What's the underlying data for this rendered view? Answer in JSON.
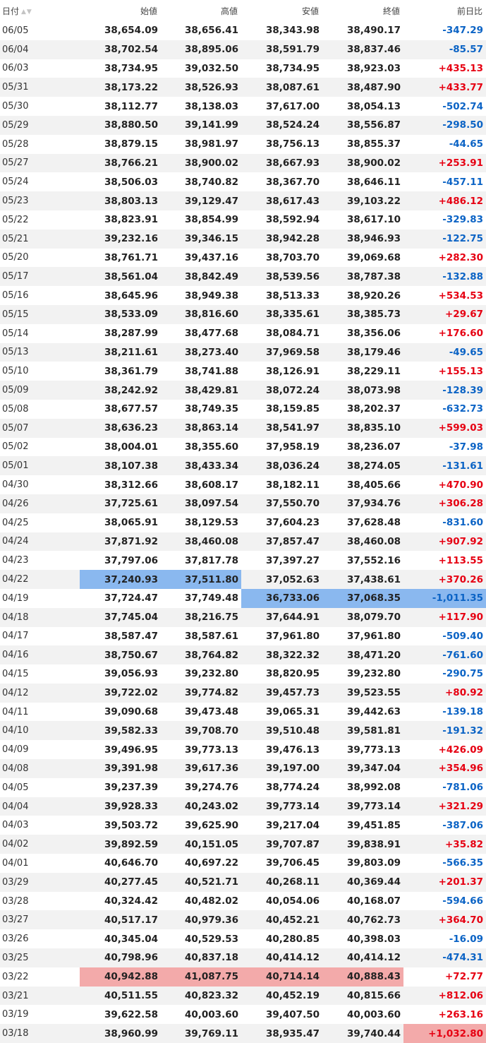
{
  "headers": {
    "date": "日付",
    "open": "始値",
    "high": "高値",
    "low": "安値",
    "close": "終値",
    "change": "前日比"
  },
  "colors": {
    "up": "#e60012",
    "down": "#0b63c5",
    "highlight_low": "#8ab8ef",
    "highlight_high": "#f3aaaa"
  },
  "rows": [
    {
      "date": "06/05",
      "open": "38,654.09",
      "high": "38,656.41",
      "low": "38,343.98",
      "close": "38,490.17",
      "change": "-347.29"
    },
    {
      "date": "06/04",
      "open": "38,702.54",
      "high": "38,895.06",
      "low": "38,591.79",
      "close": "38,837.46",
      "change": "-85.57"
    },
    {
      "date": "06/03",
      "open": "38,734.95",
      "high": "39,032.50",
      "low": "38,734.95",
      "close": "38,923.03",
      "change": "+435.13"
    },
    {
      "date": "05/31",
      "open": "38,173.22",
      "high": "38,526.93",
      "low": "38,087.61",
      "close": "38,487.90",
      "change": "+433.77"
    },
    {
      "date": "05/30",
      "open": "38,112.77",
      "high": "38,138.03",
      "low": "37,617.00",
      "close": "38,054.13",
      "change": "-502.74"
    },
    {
      "date": "05/29",
      "open": "38,880.50",
      "high": "39,141.99",
      "low": "38,524.24",
      "close": "38,556.87",
      "change": "-298.50"
    },
    {
      "date": "05/28",
      "open": "38,879.15",
      "high": "38,981.97",
      "low": "38,756.13",
      "close": "38,855.37",
      "change": "-44.65"
    },
    {
      "date": "05/27",
      "open": "38,766.21",
      "high": "38,900.02",
      "low": "38,667.93",
      "close": "38,900.02",
      "change": "+253.91"
    },
    {
      "date": "05/24",
      "open": "38,506.03",
      "high": "38,740.82",
      "low": "38,367.70",
      "close": "38,646.11",
      "change": "-457.11"
    },
    {
      "date": "05/23",
      "open": "38,803.13",
      "high": "39,129.47",
      "low": "38,617.43",
      "close": "39,103.22",
      "change": "+486.12"
    },
    {
      "date": "05/22",
      "open": "38,823.91",
      "high": "38,854.99",
      "low": "38,592.94",
      "close": "38,617.10",
      "change": "-329.83"
    },
    {
      "date": "05/21",
      "open": "39,232.16",
      "high": "39,346.15",
      "low": "38,942.28",
      "close": "38,946.93",
      "change": "-122.75"
    },
    {
      "date": "05/20",
      "open": "38,761.71",
      "high": "39,437.16",
      "low": "38,703.70",
      "close": "39,069.68",
      "change": "+282.30"
    },
    {
      "date": "05/17",
      "open": "38,561.04",
      "high": "38,842.49",
      "low": "38,539.56",
      "close": "38,787.38",
      "change": "-132.88"
    },
    {
      "date": "05/16",
      "open": "38,645.96",
      "high": "38,949.38",
      "low": "38,513.33",
      "close": "38,920.26",
      "change": "+534.53"
    },
    {
      "date": "05/15",
      "open": "38,533.09",
      "high": "38,816.60",
      "low": "38,335.61",
      "close": "38,385.73",
      "change": "+29.67"
    },
    {
      "date": "05/14",
      "open": "38,287.99",
      "high": "38,477.68",
      "low": "38,084.71",
      "close": "38,356.06",
      "change": "+176.60"
    },
    {
      "date": "05/13",
      "open": "38,211.61",
      "high": "38,273.40",
      "low": "37,969.58",
      "close": "38,179.46",
      "change": "-49.65"
    },
    {
      "date": "05/10",
      "open": "38,361.79",
      "high": "38,741.88",
      "low": "38,126.91",
      "close": "38,229.11",
      "change": "+155.13"
    },
    {
      "date": "05/09",
      "open": "38,242.92",
      "high": "38,429.81",
      "low": "38,072.24",
      "close": "38,073.98",
      "change": "-128.39"
    },
    {
      "date": "05/08",
      "open": "38,677.57",
      "high": "38,749.35",
      "low": "38,159.85",
      "close": "38,202.37",
      "change": "-632.73"
    },
    {
      "date": "05/07",
      "open": "38,636.23",
      "high": "38,863.14",
      "low": "38,541.97",
      "close": "38,835.10",
      "change": "+599.03"
    },
    {
      "date": "05/02",
      "open": "38,004.01",
      "high": "38,355.60",
      "low": "37,958.19",
      "close": "38,236.07",
      "change": "-37.98"
    },
    {
      "date": "05/01",
      "open": "38,107.38",
      "high": "38,433.34",
      "low": "38,036.24",
      "close": "38,274.05",
      "change": "-131.61"
    },
    {
      "date": "04/30",
      "open": "38,312.66",
      "high": "38,608.17",
      "low": "38,182.11",
      "close": "38,405.66",
      "change": "+470.90"
    },
    {
      "date": "04/26",
      "open": "37,725.61",
      "high": "38,097.54",
      "low": "37,550.70",
      "close": "37,934.76",
      "change": "+306.28"
    },
    {
      "date": "04/25",
      "open": "38,065.91",
      "high": "38,129.53",
      "low": "37,604.23",
      "close": "37,628.48",
      "change": "-831.60"
    },
    {
      "date": "04/24",
      "open": "37,871.92",
      "high": "38,460.08",
      "low": "37,857.47",
      "close": "38,460.08",
      "change": "+907.92"
    },
    {
      "date": "04/23",
      "open": "37,797.06",
      "high": "37,817.78",
      "low": "37,397.27",
      "close": "37,552.16",
      "change": "+113.55"
    },
    {
      "date": "04/22",
      "open": "37,240.93",
      "high": "37,511.80",
      "low": "37,052.63",
      "close": "37,438.61",
      "change": "+370.26"
    },
    {
      "date": "04/19",
      "open": "37,724.47",
      "high": "37,749.48",
      "low": "36,733.06",
      "close": "37,068.35",
      "change": "-1,011.35"
    },
    {
      "date": "04/18",
      "open": "37,745.04",
      "high": "38,216.75",
      "low": "37,644.91",
      "close": "38,079.70",
      "change": "+117.90"
    },
    {
      "date": "04/17",
      "open": "38,587.47",
      "high": "38,587.61",
      "low": "37,961.80",
      "close": "37,961.80",
      "change": "-509.40"
    },
    {
      "date": "04/16",
      "open": "38,750.67",
      "high": "38,764.82",
      "low": "38,322.32",
      "close": "38,471.20",
      "change": "-761.60"
    },
    {
      "date": "04/15",
      "open": "39,056.93",
      "high": "39,232.80",
      "low": "38,820.95",
      "close": "39,232.80",
      "change": "-290.75"
    },
    {
      "date": "04/12",
      "open": "39,722.02",
      "high": "39,774.82",
      "low": "39,457.73",
      "close": "39,523.55",
      "change": "+80.92"
    },
    {
      "date": "04/11",
      "open": "39,090.68",
      "high": "39,473.48",
      "low": "39,065.31",
      "close": "39,442.63",
      "change": "-139.18"
    },
    {
      "date": "04/10",
      "open": "39,582.33",
      "high": "39,708.70",
      "low": "39,510.48",
      "close": "39,581.81",
      "change": "-191.32"
    },
    {
      "date": "04/09",
      "open": "39,496.95",
      "high": "39,773.13",
      "low": "39,476.13",
      "close": "39,773.13",
      "change": "+426.09"
    },
    {
      "date": "04/08",
      "open": "39,391.98",
      "high": "39,617.36",
      "low": "39,197.00",
      "close": "39,347.04",
      "change": "+354.96"
    },
    {
      "date": "04/05",
      "open": "39,237.39",
      "high": "39,274.76",
      "low": "38,774.24",
      "close": "38,992.08",
      "change": "-781.06"
    },
    {
      "date": "04/04",
      "open": "39,928.33",
      "high": "40,243.02",
      "low": "39,773.14",
      "close": "39,773.14",
      "change": "+321.29"
    },
    {
      "date": "04/03",
      "open": "39,503.72",
      "high": "39,625.90",
      "low": "39,217.04",
      "close": "39,451.85",
      "change": "-387.06"
    },
    {
      "date": "04/02",
      "open": "39,892.59",
      "high": "40,151.05",
      "low": "39,707.87",
      "close": "39,838.91",
      "change": "+35.82"
    },
    {
      "date": "04/01",
      "open": "40,646.70",
      "high": "40,697.22",
      "low": "39,706.45",
      "close": "39,803.09",
      "change": "-566.35"
    },
    {
      "date": "03/29",
      "open": "40,277.45",
      "high": "40,521.71",
      "low": "40,268.11",
      "close": "40,369.44",
      "change": "+201.37"
    },
    {
      "date": "03/28",
      "open": "40,324.42",
      "high": "40,482.02",
      "low": "40,054.06",
      "close": "40,168.07",
      "change": "-594.66"
    },
    {
      "date": "03/27",
      "open": "40,517.17",
      "high": "40,979.36",
      "low": "40,452.21",
      "close": "40,762.73",
      "change": "+364.70"
    },
    {
      "date": "03/26",
      "open": "40,345.04",
      "high": "40,529.53",
      "low": "40,280.85",
      "close": "40,398.03",
      "change": "-16.09"
    },
    {
      "date": "03/25",
      "open": "40,798.96",
      "high": "40,837.18",
      "low": "40,414.12",
      "close": "40,414.12",
      "change": "-474.31"
    },
    {
      "date": "03/22",
      "open": "40,942.88",
      "high": "41,087.75",
      "low": "40,714.14",
      "close": "40,888.43",
      "change": "+72.77"
    },
    {
      "date": "03/21",
      "open": "40,511.55",
      "high": "40,823.32",
      "low": "40,452.19",
      "close": "40,815.66",
      "change": "+812.06"
    },
    {
      "date": "03/19",
      "open": "39,622.58",
      "high": "40,003.60",
      "low": "39,407.50",
      "close": "40,003.60",
      "change": "+263.16"
    },
    {
      "date": "03/18",
      "open": "38,960.99",
      "high": "39,769.11",
      "low": "38,935.47",
      "close": "39,740.44",
      "change": "+1,032.80"
    }
  ],
  "highlights": {
    "04/22": {
      "open": "low",
      "high": "low"
    },
    "04/19": {
      "low": "low",
      "close": "low",
      "change": "low"
    },
    "03/22": {
      "open": "high",
      "high": "high",
      "low": "high",
      "close": "high"
    },
    "03/18": {
      "change": "high"
    }
  }
}
